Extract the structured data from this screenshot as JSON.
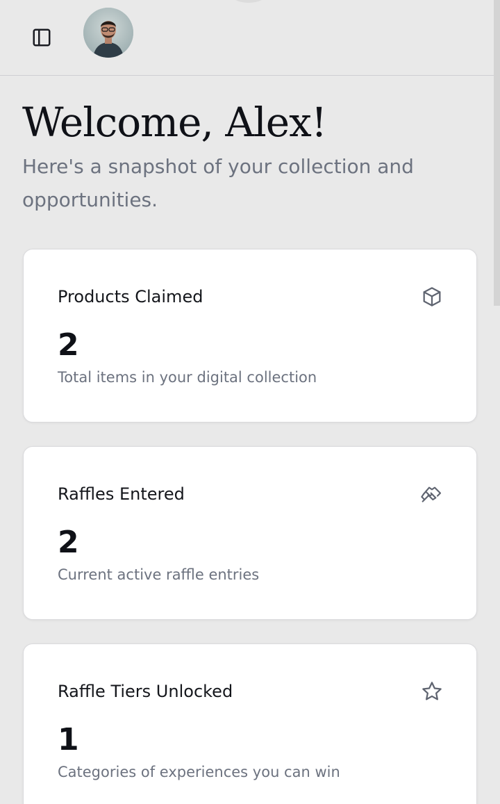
{
  "header": {
    "sidebar_toggle_icon": "sidebar-toggle-icon",
    "avatar_icon": "user-avatar"
  },
  "welcome": {
    "title": "Welcome, Alex!",
    "subtitle": "Here's a snapshot of your collection and opportunities."
  },
  "stats": [
    {
      "title": "Products Claimed",
      "value": "2",
      "description": "Total items in your digital collection",
      "icon": "box-icon"
    },
    {
      "title": "Raffles Entered",
      "value": "2",
      "description": "Current active raffle entries",
      "icon": "ticket-icon"
    },
    {
      "title": "Raffle Tiers Unlocked",
      "value": "1",
      "description": "Categories of experiences you can win",
      "icon": "star-icon"
    }
  ],
  "colors": {
    "background": "#e9e9e9",
    "card": "#ffffff",
    "text_primary": "#0f1117",
    "text_muted": "#6c727f",
    "icon": "#5f6470"
  }
}
